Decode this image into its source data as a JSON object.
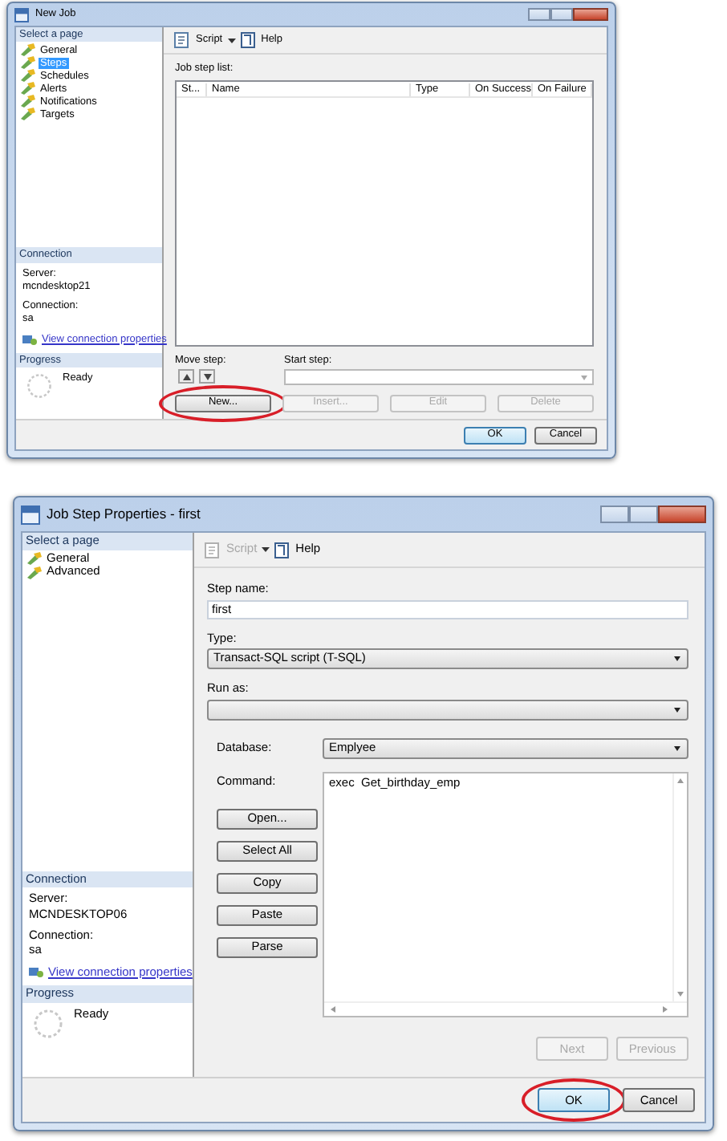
{
  "new_job": {
    "title": "New Job",
    "sidebar_header": "Select a page",
    "pages": [
      {
        "label": "General",
        "selected": false
      },
      {
        "label": "Steps",
        "selected": true
      },
      {
        "label": "Schedules",
        "selected": false
      },
      {
        "label": "Alerts",
        "selected": false
      },
      {
        "label": "Notifications",
        "selected": false
      },
      {
        "label": "Targets",
        "selected": false
      }
    ],
    "connection": {
      "header": "Connection",
      "server_label": "Server:",
      "server": "mcndesktop21",
      "connection_label": "Connection:",
      "connection": "sa",
      "link": "View connection properties"
    },
    "progress": {
      "header": "Progress",
      "status": "Ready"
    },
    "toolbar": {
      "script": "Script",
      "script_disabled": false,
      "help": "Help"
    },
    "step_list_label": "Job step list:",
    "columns": [
      "St...",
      "Name",
      "Type",
      "On Success",
      "On Failure"
    ],
    "move_step_label": "Move step:",
    "start_step_label": "Start step:",
    "step_buttons": [
      {
        "label": "New...",
        "disabled": false,
        "circled": true
      },
      {
        "label": "Insert...",
        "disabled": true,
        "circled": false
      },
      {
        "label": "Edit",
        "disabled": true,
        "circled": false
      },
      {
        "label": "Delete",
        "disabled": true,
        "circled": false
      }
    ],
    "footer_buttons": [
      {
        "label": "OK",
        "default": true,
        "circled": false
      },
      {
        "label": "Cancel",
        "default": false,
        "circled": false
      }
    ]
  },
  "job_step_properties": {
    "title": "Job Step Properties - first",
    "sidebar_header": "Select a page",
    "pages": [
      {
        "label": "General",
        "selected": false
      },
      {
        "label": "Advanced",
        "selected": false
      }
    ],
    "connection": {
      "header": "Connection",
      "server_label": "Server:",
      "server": "MCNDESKTOP06",
      "connection_label": "Connection:",
      "connection": "sa",
      "link": "View connection properties"
    },
    "progress": {
      "header": "Progress",
      "status": "Ready"
    },
    "toolbar": {
      "script": "Script",
      "script_disabled": true,
      "help": "Help"
    },
    "step_name": {
      "label": "Step name:",
      "value": "first"
    },
    "type": {
      "label": "Type:",
      "value": "Transact-SQL script (T-SQL)"
    },
    "run_as": {
      "label": "Run as:"
    },
    "database": {
      "label": "Database:",
      "value": "Emplyee"
    },
    "command": {
      "label": "Command:",
      "value": "exec  Get_birthday_emp"
    },
    "command_buttons": [
      {
        "label": "Open..."
      },
      {
        "label": "Select All"
      },
      {
        "label": "Copy"
      },
      {
        "label": "Paste"
      },
      {
        "label": "Parse"
      }
    ],
    "nav_buttons": [
      {
        "label": "Next",
        "disabled": true
      },
      {
        "label": "Previous",
        "disabled": true
      }
    ],
    "footer_buttons": [
      {
        "label": "OK",
        "default": true,
        "circled": true
      },
      {
        "label": "Cancel",
        "default": false,
        "circled": false
      }
    ]
  }
}
